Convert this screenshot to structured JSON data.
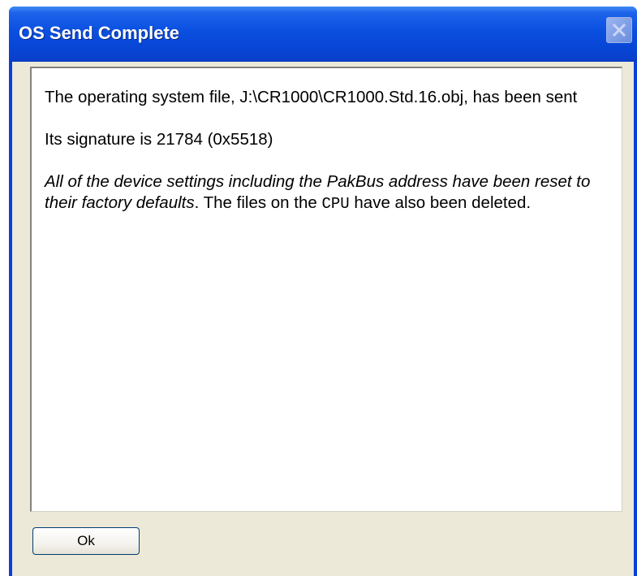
{
  "window": {
    "title": "OS Send Complete"
  },
  "message": {
    "line1": "The operating system file, J:\\CR1000\\CR1000.Std.16.obj, has been sent",
    "signature": "Its signature is 21784 (0x5518)",
    "reset_italic": "All of the device settings including the PakBus address have been reset to their factory defaults",
    "reset_tail_1": ". The files on the ",
    "reset_cpu": "CPU",
    "reset_tail_2": " have also been deleted."
  },
  "buttons": {
    "ok_label": "Ok"
  },
  "icons": {
    "close": "close-icon"
  },
  "colors": {
    "titlebar": "#0a4fe0",
    "dialog_face": "#ece9d8",
    "title_text": "#ffffff"
  }
}
